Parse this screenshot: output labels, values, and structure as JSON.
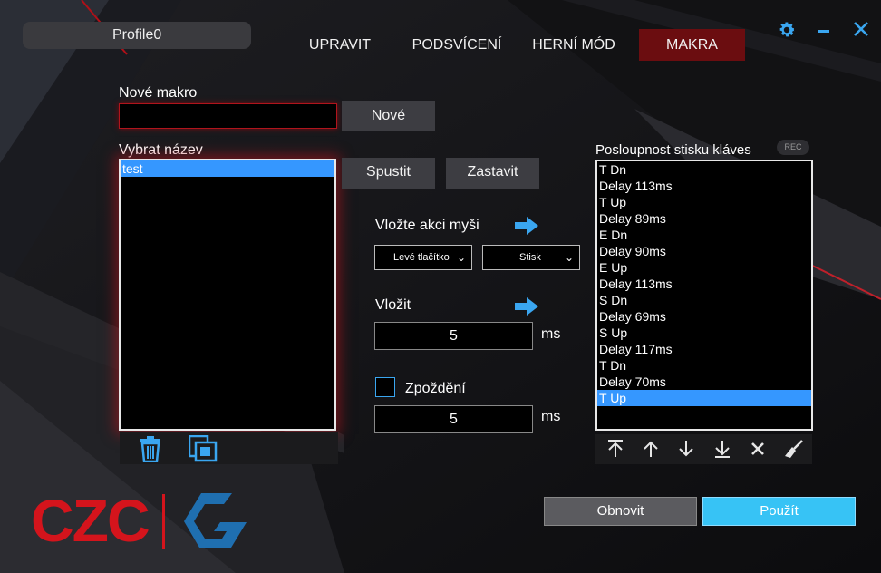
{
  "window": {
    "profile_name": "Profile0",
    "settings_icon": "gear-icon",
    "minimize_icon": "minimize-icon",
    "close_icon": "close-icon"
  },
  "tabs": [
    {
      "label": "UPRAVIT",
      "active": false
    },
    {
      "label": "PODSVÍCENÍ",
      "active": false
    },
    {
      "label": "HERNÍ MÓD",
      "active": false
    },
    {
      "label": "MAKRA",
      "active": true
    }
  ],
  "new_macro": {
    "label": "Nové makro",
    "input_value": "",
    "button": "Nové"
  },
  "select_name": {
    "label": "Vybrat název",
    "items": [
      {
        "label": "test",
        "selected": true
      }
    ],
    "run_button": "Spustit",
    "stop_button": "Zastavit",
    "delete_icon": "trash-icon",
    "copy_icon": "copy-icon"
  },
  "mouse_action": {
    "label": "Vložte akci myši",
    "button_value": "Levé tlačítko",
    "action_value": "Stisk"
  },
  "insert": {
    "label": "Vložit",
    "value": "5",
    "unit": "ms"
  },
  "delay": {
    "label": "Zpoždění",
    "checked": false,
    "value": "5",
    "unit": "ms"
  },
  "sequence": {
    "label": "Posloupnost stisku kláves",
    "rec_label": "REC",
    "items": [
      "T Dn",
      "Delay 113ms",
      "T Up",
      "Delay 89ms",
      "E Dn",
      "Delay 90ms",
      "E Up",
      "Delay 113ms",
      "S Dn",
      "Delay 69ms",
      "S Up",
      "Delay 117ms",
      "T Dn",
      "Delay 70ms",
      "T Up"
    ],
    "selected_index": 14,
    "tools": [
      "move-top-icon",
      "move-up-icon",
      "move-down-icon",
      "move-bottom-icon",
      "delete-x-icon",
      "clear-broom-icon"
    ]
  },
  "footer": {
    "reset_button": "Obnovit",
    "apply_button": "Použít",
    "logo_text": "CZC",
    "colors": {
      "brand_red": "#d4141c",
      "accent_blue": "#37c3f5",
      "logo_blue": "#1f6fb0"
    }
  }
}
